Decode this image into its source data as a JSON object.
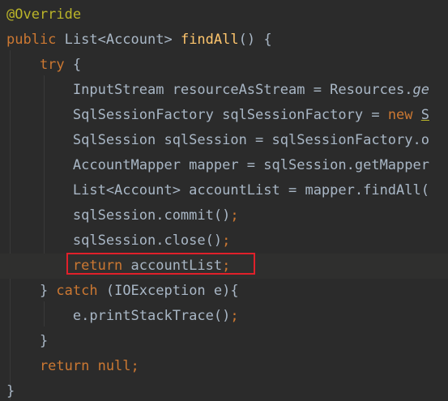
{
  "editor": {
    "lines": [
      [
        {
          "t": "@Override",
          "c": "c-annotation"
        }
      ],
      [
        {
          "t": "public ",
          "c": "c-keyword"
        },
        {
          "t": "List<Account> ",
          "c": "c-plain"
        },
        {
          "t": "findAll",
          "c": "c-method"
        },
        {
          "t": "() {",
          "c": "c-plain"
        }
      ],
      [
        {
          "t": "    try ",
          "c": "c-keyword"
        },
        {
          "t": "{",
          "c": "c-plain"
        }
      ],
      [
        {
          "t": "        InputStream resourceAsStream = Resources.",
          "c": "c-plain"
        },
        {
          "t": "ge",
          "c": "c-static"
        }
      ],
      [
        {
          "t": "        SqlSessionFactory sqlSessionFactory = ",
          "c": "c-plain"
        },
        {
          "t": "new ",
          "c": "c-new"
        },
        {
          "t": "S",
          "c": "c-plain c-underline"
        }
      ],
      [
        {
          "t": "        SqlSession sqlSession = sqlSessionFactory.",
          "c": "c-plain"
        },
        {
          "t": "o",
          "c": "c-plain"
        }
      ],
      [
        {
          "t": "        AccountMapper mapper = sqlSession.getMapper",
          "c": "c-plain"
        }
      ],
      [
        {
          "t": "        List<Account> accountList = mapper.findAll(",
          "c": "c-plain"
        }
      ],
      [
        {
          "t": "        sqlSession.commit()",
          "c": "c-plain"
        },
        {
          "t": ";",
          "c": "c-punct"
        }
      ],
      [
        {
          "t": "        sqlSession.close()",
          "c": "c-plain"
        },
        {
          "t": ";",
          "c": "c-punct"
        }
      ],
      [
        {
          "t": "        return ",
          "c": "c-keyword"
        },
        {
          "t": "accountList",
          "c": "c-plain"
        },
        {
          "t": ";",
          "c": "c-punct"
        }
      ],
      [
        {
          "t": "    } ",
          "c": "c-plain"
        },
        {
          "t": "catch ",
          "c": "c-keyword"
        },
        {
          "t": "(IOException e){",
          "c": "c-plain"
        }
      ],
      [
        {
          "t": "        e.printStackTrace()",
          "c": "c-plain"
        },
        {
          "t": ";",
          "c": "c-punct"
        }
      ],
      [
        {
          "t": "    }",
          "c": "c-plain"
        }
      ],
      [
        {
          "t": "    return null",
          "c": "c-keyword"
        },
        {
          "t": ";",
          "c": "c-punct"
        }
      ],
      [
        {
          "t": "}",
          "c": "c-plain"
        }
      ]
    ],
    "highlighted_line": 10,
    "highlight_box_label": "return accountList;"
  }
}
